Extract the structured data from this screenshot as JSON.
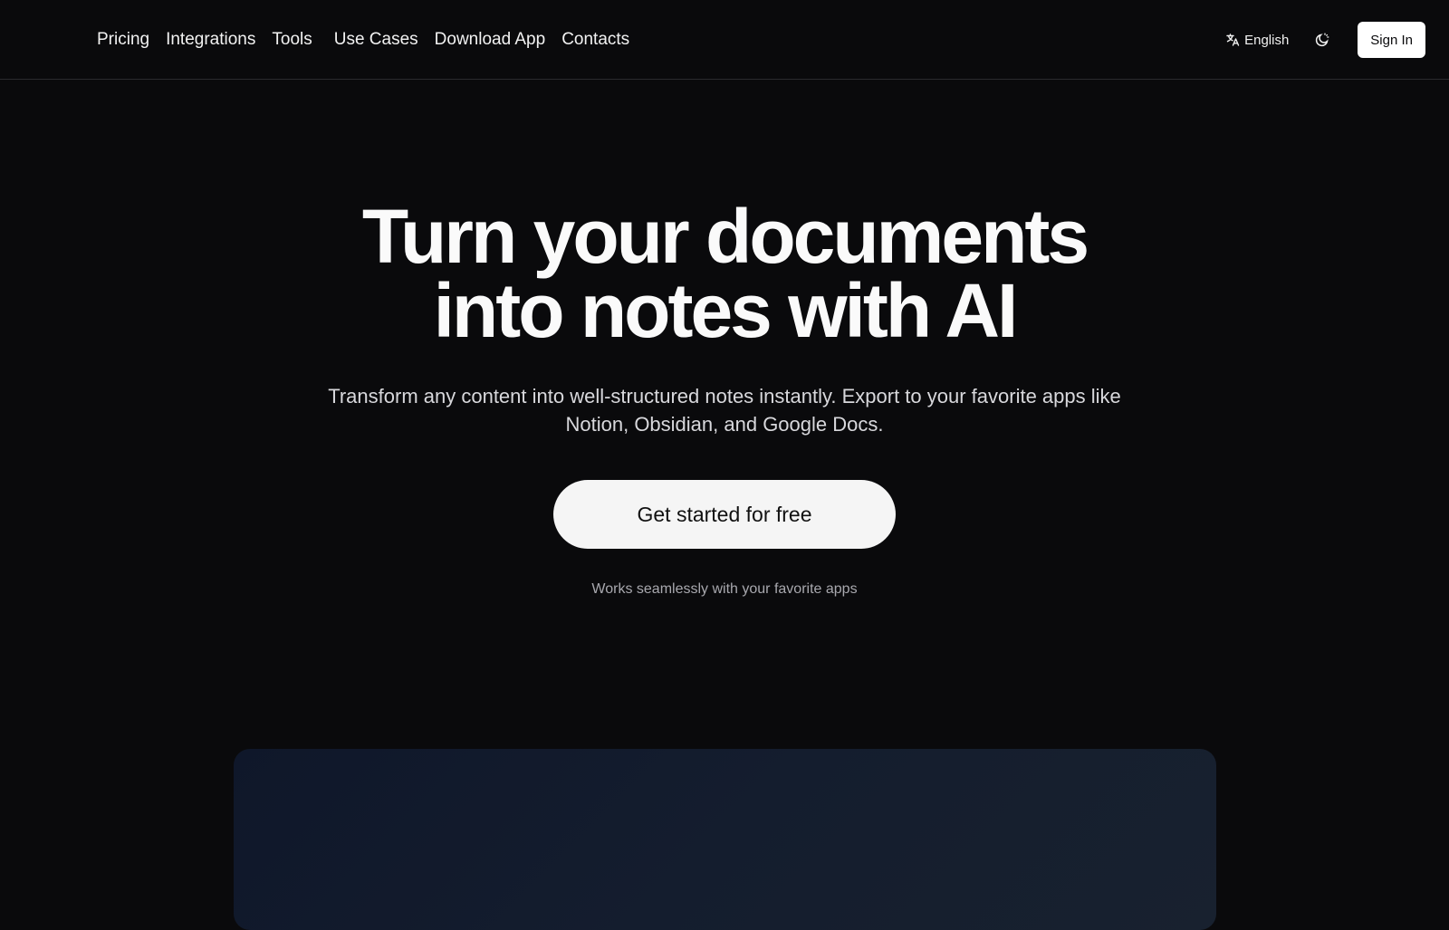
{
  "nav": {
    "links": [
      "Pricing",
      "Integrations",
      "Tools",
      "Use Cases",
      "Download App",
      "Contacts"
    ],
    "language": "English",
    "sign_in": "Sign In"
  },
  "hero": {
    "title_line1": "Turn your documents",
    "title_line2": "into notes with AI",
    "subtitle": "Transform any content into well-structured notes instantly. Export to your favorite apps like Notion, Obsidian, and Google Docs.",
    "cta": "Get started for free",
    "works_with": "Works seamlessly with your favorite apps"
  },
  "icons": {
    "language": "translate-icon",
    "theme": "theme-toggle-icon"
  },
  "colors": {
    "background": "#0a0a0c",
    "text": "#f5f5f5",
    "button_bg": "#f5f5f5",
    "preview_bg": "#141d2e"
  }
}
